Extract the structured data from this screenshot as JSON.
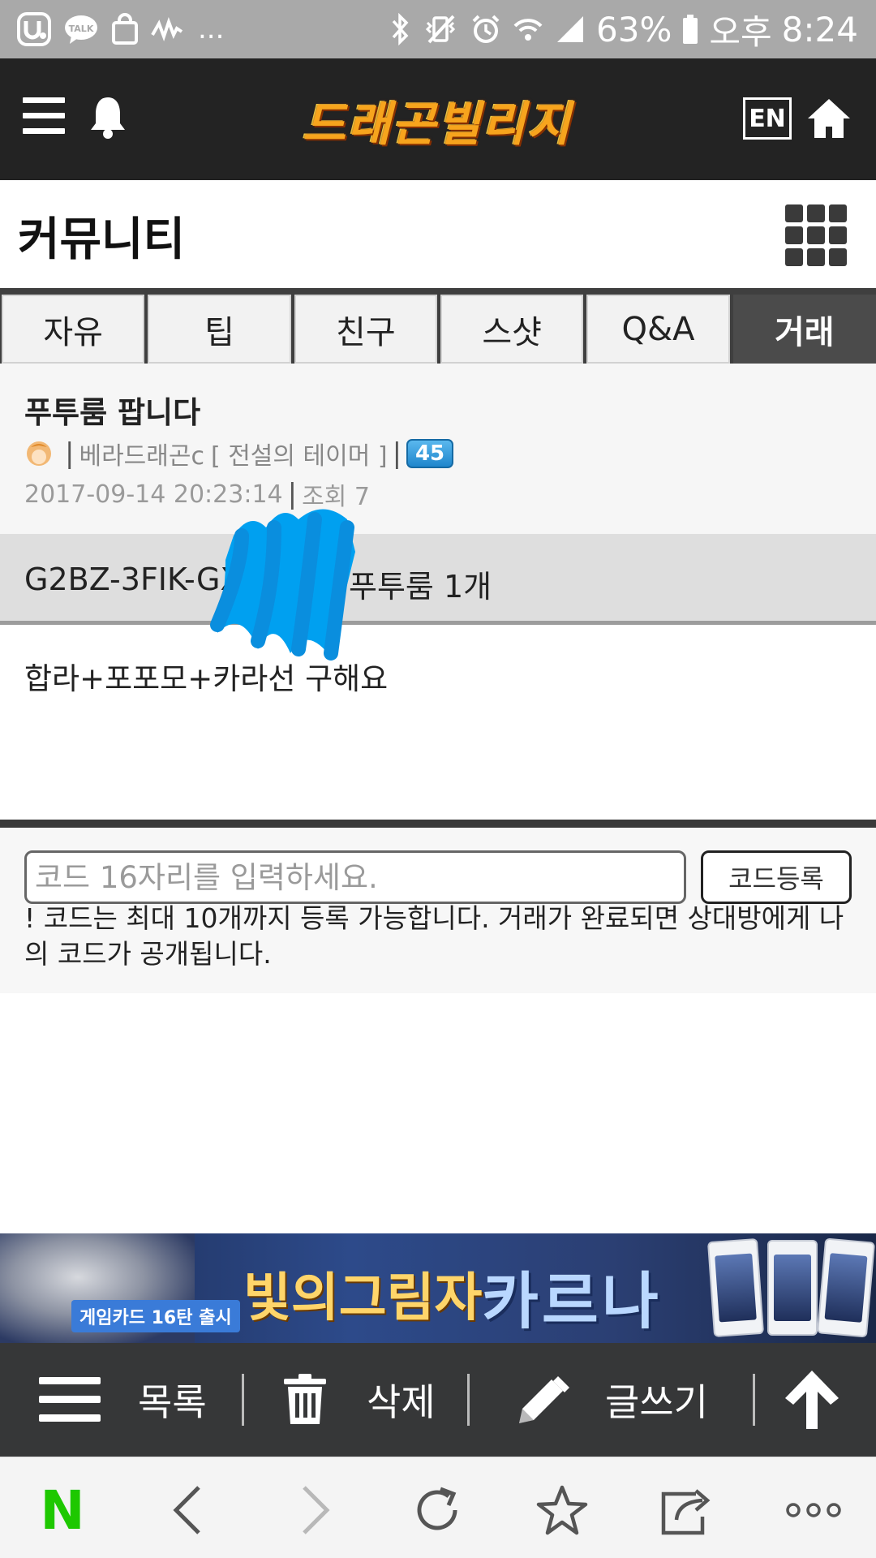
{
  "status_bar": {
    "battery_percent": "63%",
    "ampm": "오후",
    "time": "8:24",
    "more": "...",
    "left_icons": [
      "utalk-icon",
      "kakaotalk-icon",
      "shopping-bag-icon",
      "stock-chart-icon"
    ],
    "right_icons": [
      "bluetooth-icon",
      "vibrate-mute-icon",
      "alarm-icon",
      "wifi-icon",
      "signal-icon",
      "battery-icon"
    ]
  },
  "header": {
    "logo_text": "드래곤빌리지",
    "lang_label": "EN",
    "icons": [
      "menu-icon",
      "bell-icon",
      "home-icon"
    ]
  },
  "page": {
    "title": "커뮤니티"
  },
  "tabs": [
    {
      "label": "자유",
      "active": false
    },
    {
      "label": "팁",
      "active": false
    },
    {
      "label": "친구",
      "active": false
    },
    {
      "label": "스샷",
      "active": false
    },
    {
      "label": "Q&A",
      "active": false
    },
    {
      "label": "거래",
      "active": true
    }
  ],
  "post": {
    "title": "푸투룸 팝니다",
    "author": "베라드래곤c",
    "author_title": "[ 전설의 테이머 ]",
    "level": "45",
    "date": "2017-09-14 20:23:14",
    "views": "조회 7",
    "code_prefix": "G2BZ-3FIK-GX",
    "code_suffix": "푸투룸 1개",
    "body": "합라+포포모+카라선 구해요"
  },
  "code_register": {
    "placeholder": "코드 16자리를 입력하세요.",
    "button_label": "코드등록",
    "note": "! 코드는 최대 10개까지 등록 가능합니다. 거래가 완료되면 상대방에게 나의 코드가 공개됩니다."
  },
  "banner": {
    "badge": "게임카드 16탄 출시",
    "title_part1": "빛의그림자",
    "title_part2": "카르나"
  },
  "action_bar": {
    "list_label": "목록",
    "delete_label": "삭제",
    "write_label": "글쓰기"
  },
  "browser_bar": {
    "home_logo": "N",
    "icons": [
      "back-icon",
      "forward-icon",
      "reload-icon",
      "bookmark-star-icon",
      "share-icon",
      "more-icon"
    ]
  },
  "colors": {
    "header_bg": "#232323",
    "active_tab": "#4b4b4b",
    "naver_green": "#1ec800",
    "level_badge": "#1f86cc",
    "scribble": "#00a0f0"
  }
}
